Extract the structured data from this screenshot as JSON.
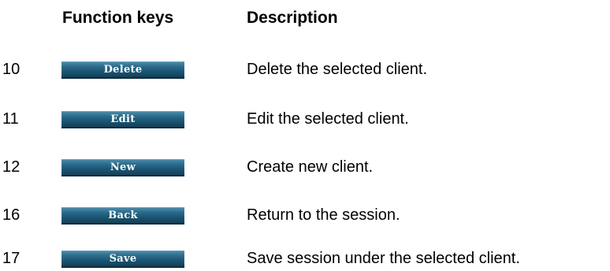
{
  "headers": {
    "function_keys": "Function keys",
    "description": "Description"
  },
  "rows": [
    {
      "number": "10",
      "key_label": "Delete",
      "description": "Delete the selected client."
    },
    {
      "number": "11",
      "key_label": "Edit",
      "description": "Edit the selected client."
    },
    {
      "number": "12",
      "key_label": "New",
      "description": "Create new client."
    },
    {
      "number": "16",
      "key_label": "Back",
      "description": "Return to the session."
    },
    {
      "number": "17",
      "key_label": "Save",
      "description": "Save session under the selected client."
    }
  ],
  "colors": {
    "button_gradient_top": "#4b8aa9",
    "button_gradient_bottom": "#143f57",
    "button_text": "#ffffff"
  }
}
